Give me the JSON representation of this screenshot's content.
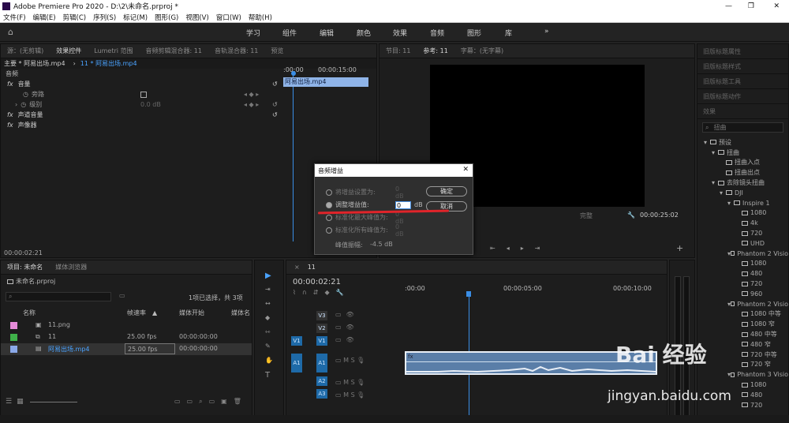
{
  "window": {
    "title": "Adobe Premiere Pro 2020 - D:\\2\\未命名.prproj *",
    "minimize": "—",
    "maximize": "❐",
    "close": "✕"
  },
  "menu": [
    "文件(F)",
    "编辑(E)",
    "剪辑(C)",
    "序列(S)",
    "标记(M)",
    "图形(G)",
    "视图(V)",
    "窗口(W)",
    "帮助(H)"
  ],
  "workspaces": [
    "学习",
    "组件",
    "编辑",
    "颜色",
    "效果",
    "音频",
    "图形",
    "库"
  ],
  "workspace_more": "»",
  "effect_controls": {
    "tabs": [
      "源：(无剪辑)",
      "效果控件",
      "Lumetri 范围",
      "音频剪辑混合器: 11",
      "音轨混合器: 11",
      "预览"
    ],
    "master": "主要 * 阿易出场.mp4",
    "clip": "11 * 阿易出场.mp4",
    "ruler": [
      ":00:00",
      "00:00:15:00"
    ],
    "clip_block": "阿易出场.mp4",
    "section": "音频",
    "fx_volume": "音量",
    "bypass": "旁路",
    "level": "级别",
    "level_value": "0.0 dB",
    "fx_channel": "声道音量",
    "fx_panner": "声像器",
    "timecode": "00:00:02:21"
  },
  "program": {
    "tabs": [
      "节目: 11",
      "参考: 11",
      "字幕：(无字幕)"
    ],
    "timecode": "00:00:25:02",
    "fit_label": "完整"
  },
  "dialog": {
    "title": "音频增益",
    "options": [
      {
        "label": "将增益设置为:",
        "value": "0 dB"
      },
      {
        "label": "调整增益值:",
        "value": "0",
        "unit": "dB"
      },
      {
        "label": "标准化最大峰值为:",
        "value": "0 dB"
      },
      {
        "label": "标准化所有峰值为:",
        "value": "0 dB"
      }
    ],
    "ok": "确定",
    "cancel": "取消",
    "peak_label": "峰值振幅:",
    "peak_value": "-4.5 dB"
  },
  "project": {
    "tabs": [
      "项目: 未命名",
      "媒体浏览器"
    ],
    "name": "未命名.prproj",
    "selection": "1项已选择，共 3项",
    "columns": [
      "名称",
      "帧速率",
      "媒体开始",
      "媒体名"
    ],
    "rows": [
      {
        "name": "11.png",
        "fps": "",
        "start": "",
        "color": "#e48ad8"
      },
      {
        "name": "11",
        "fps": "25.00 fps",
        "start": "00:00:00:00",
        "color": "#3fb24a"
      },
      {
        "name": "阿易出场.mp4",
        "fps": "25.00 fps",
        "start": "00:00:00:00",
        "color": "#8aa8e8"
      }
    ]
  },
  "timeline": {
    "tab": "11",
    "timecode": "00:00:02:21",
    "ruler": [
      ":00:00",
      "00:00:05:00",
      "00:00:10:00"
    ],
    "tracks": [
      "V3",
      "V2",
      "V1",
      "A1",
      "A2",
      "A3"
    ],
    "src_v": "V1",
    "src_a": "A1",
    "btn_m": "M",
    "btn_s": "S"
  },
  "effects": {
    "tabs": [
      "旧版标题属性",
      "旧版标题样式",
      "旧版标题工具",
      "旧版标题动作",
      "效果"
    ],
    "search": "扭曲",
    "tree": [
      {
        "label": "预设",
        "level": 0,
        "folder": true
      },
      {
        "label": "扭曲",
        "level": 1,
        "folder": true
      },
      {
        "label": "扭曲入点",
        "level": 2,
        "folder": false
      },
      {
        "label": "扭曲出点",
        "level": 2,
        "folder": false
      },
      {
        "label": "去除镜头扭曲",
        "level": 1,
        "folder": true
      },
      {
        "label": "DJI",
        "level": 2,
        "folder": true
      },
      {
        "label": "Inspire 1",
        "level": 3,
        "folder": true
      },
      {
        "label": "1080",
        "level": 4,
        "folder": false
      },
      {
        "label": "4k",
        "level": 4,
        "folder": false
      },
      {
        "label": "720",
        "level": 4,
        "folder": false
      },
      {
        "label": "UHD",
        "level": 4,
        "folder": false
      },
      {
        "label": "Phantom 2 Visio",
        "level": 3,
        "folder": true
      },
      {
        "label": "1080",
        "level": 4,
        "folder": false
      },
      {
        "label": "480",
        "level": 4,
        "folder": false
      },
      {
        "label": "720",
        "level": 4,
        "folder": false
      },
      {
        "label": "960",
        "level": 4,
        "folder": false
      },
      {
        "label": "Phantom 2 Visio",
        "level": 3,
        "folder": true
      },
      {
        "label": "1080 中等",
        "level": 4,
        "folder": false
      },
      {
        "label": "1080 窄",
        "level": 4,
        "folder": false
      },
      {
        "label": "480 中等",
        "level": 4,
        "folder": false
      },
      {
        "label": "480 窄",
        "level": 4,
        "folder": false
      },
      {
        "label": "720 中等",
        "level": 4,
        "folder": false
      },
      {
        "label": "720 窄",
        "level": 4,
        "folder": false
      },
      {
        "label": "Phantom 3 Visio",
        "level": 3,
        "folder": true
      },
      {
        "label": "1080",
        "level": 4,
        "folder": false
      },
      {
        "label": "480",
        "level": 4,
        "folder": false
      },
      {
        "label": "720",
        "level": 4,
        "folder": false
      }
    ]
  },
  "watermark": {
    "brand": "Bai 经验",
    "url": "jingyan.baidu.com"
  }
}
